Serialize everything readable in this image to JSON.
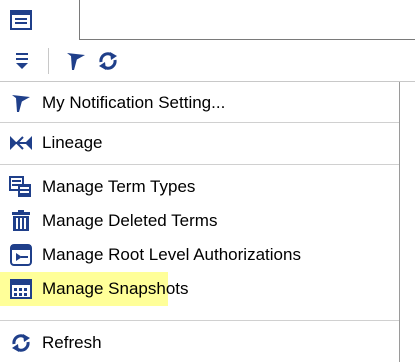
{
  "menu": {
    "items": [
      {
        "label": "My Notification Setting...",
        "icon": "notification-flag-icon"
      },
      {
        "label": "Lineage",
        "icon": "lineage-icon"
      },
      {
        "label": "Manage Term Types",
        "icon": "term-types-icon"
      },
      {
        "label": "Manage Deleted Terms",
        "icon": "trash-icon"
      },
      {
        "label": "Manage Root Level Authorizations",
        "icon": "authorization-icon"
      },
      {
        "label": "Manage Snapshots",
        "icon": "snapshot-calendar-icon"
      },
      {
        "label": "Refresh",
        "icon": "refresh-icon"
      }
    ]
  },
  "colors": {
    "highlight": "#ffff99",
    "icon_blue": "#1f4e9c",
    "border": "#7a7a7a"
  }
}
